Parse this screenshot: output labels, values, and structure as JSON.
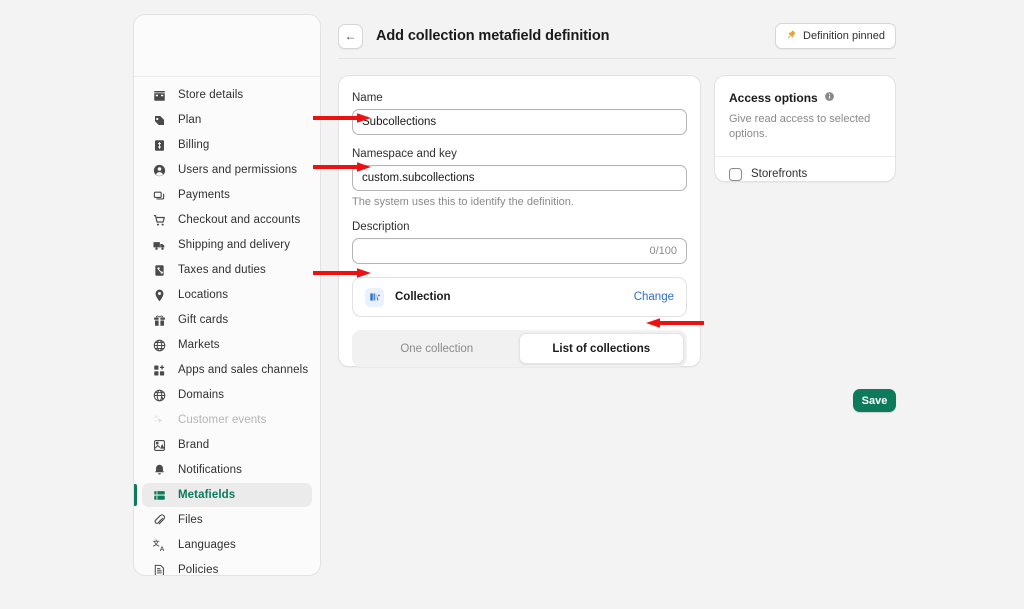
{
  "app": {
    "background_color": "#f3f3f3",
    "accent_green": "#0b7a5d",
    "link_blue": "#2c6ecb",
    "annotation_color": "#ee1111"
  },
  "header": {
    "back_icon": "arrow-left-icon",
    "title": "Add collection metafield definition",
    "pinned_button": {
      "label": "Definition pinned",
      "icon": "pushpin-icon",
      "icon_color": "#e8a33d"
    }
  },
  "sidebar": {
    "items": [
      {
        "label": "Store details",
        "icon": "store-icon",
        "state": "default"
      },
      {
        "label": "Plan",
        "icon": "plan-icon",
        "state": "default"
      },
      {
        "label": "Billing",
        "icon": "billing-icon",
        "state": "default"
      },
      {
        "label": "Users and permissions",
        "icon": "user-icon",
        "state": "default"
      },
      {
        "label": "Payments",
        "icon": "payments-icon",
        "state": "default"
      },
      {
        "label": "Checkout and accounts",
        "icon": "cart-icon",
        "state": "default"
      },
      {
        "label": "Shipping and delivery",
        "icon": "truck-icon",
        "state": "default"
      },
      {
        "label": "Taxes and duties",
        "icon": "taxes-icon",
        "state": "default"
      },
      {
        "label": "Locations",
        "icon": "location-pin-icon",
        "state": "default"
      },
      {
        "label": "Gift cards",
        "icon": "gift-card-icon",
        "state": "default"
      },
      {
        "label": "Markets",
        "icon": "globe-icon",
        "state": "default"
      },
      {
        "label": "Apps and sales channels",
        "icon": "apps-icon",
        "state": "default"
      },
      {
        "label": "Domains",
        "icon": "domains-globe-icon",
        "state": "default"
      },
      {
        "label": "Customer events",
        "icon": "cursor-sparkle-icon",
        "state": "disabled"
      },
      {
        "label": "Brand",
        "icon": "brand-image-icon",
        "state": "default"
      },
      {
        "label": "Notifications",
        "icon": "bell-icon",
        "state": "default"
      },
      {
        "label": "Metafields",
        "icon": "metafields-icon",
        "state": "active"
      },
      {
        "label": "Files",
        "icon": "paperclip-icon",
        "state": "default"
      },
      {
        "label": "Languages",
        "icon": "languages-icon",
        "state": "default"
      },
      {
        "label": "Policies",
        "icon": "policies-icon",
        "state": "default"
      }
    ]
  },
  "form": {
    "name_label": "Name",
    "name_value": "Subcollections",
    "namespace_label": "Namespace and key",
    "namespace_value": "custom.subcollections",
    "namespace_help": "The system uses this to identify the definition.",
    "description_label": "Description",
    "description_value": "",
    "description_counter": "0/100",
    "type": {
      "name": "Collection",
      "icon": "collection-icon",
      "change_label": "Change"
    },
    "segmented": {
      "options": [
        "One collection",
        "List of collections"
      ],
      "selected": "List of collections"
    }
  },
  "access": {
    "title": "Access options",
    "info_icon": "info-icon",
    "description": "Give read access to selected options.",
    "checkbox_label": "Storefronts",
    "checked": false
  },
  "actions": {
    "save_label": "Save"
  },
  "annotations": [
    {
      "name": "arrow-to-name-field",
      "direction": "right"
    },
    {
      "name": "arrow-to-namespace-field",
      "direction": "right"
    },
    {
      "name": "arrow-to-type-card",
      "direction": "right"
    },
    {
      "name": "arrow-to-list-of-collections",
      "direction": "left"
    }
  ]
}
